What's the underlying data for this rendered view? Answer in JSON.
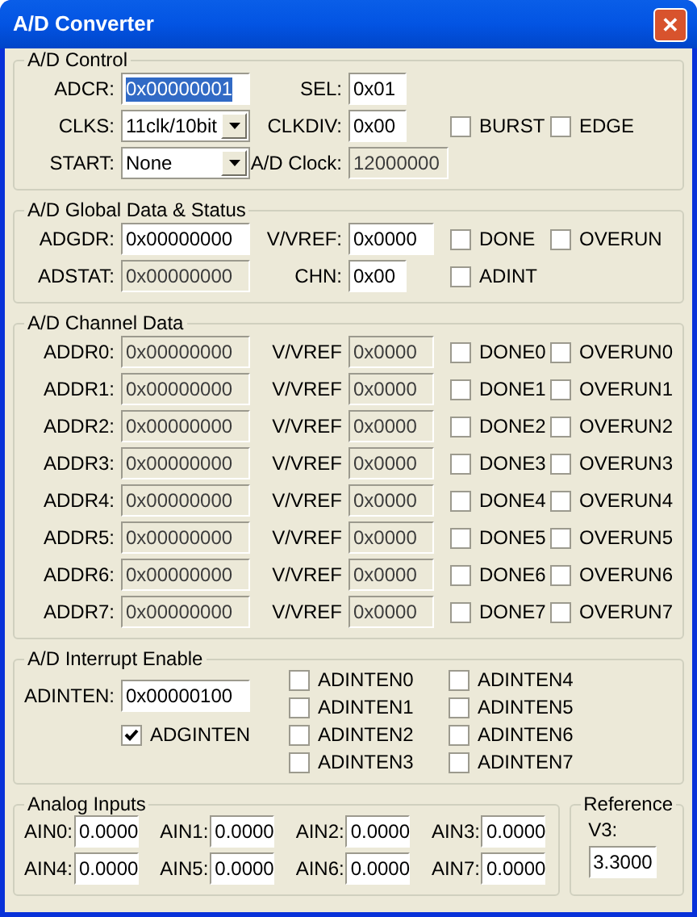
{
  "window": {
    "title": "A/D Converter",
    "close": "✕"
  },
  "ad_control": {
    "title": "A/D Control",
    "adcr": {
      "label": "ADCR:",
      "value": "0x00000001",
      "readonly": false,
      "text_selected": true
    },
    "sel": {
      "label": "SEL:",
      "value": "0x01",
      "readonly": false
    },
    "clks": {
      "label": "CLKS:",
      "value": "11clk/10bit"
    },
    "clkdiv": {
      "label": "CLKDIV:",
      "value": "0x00",
      "readonly": false
    },
    "start": {
      "label": "START:",
      "value": "None"
    },
    "ad_clock": {
      "label": "A/D Clock:",
      "value": "12000000",
      "readonly": true
    },
    "checkboxes": [
      {
        "label": "BURST",
        "checked": false
      },
      {
        "label": "EDGE",
        "checked": false
      }
    ]
  },
  "global": {
    "title": "A/D Global Data & Status",
    "adgdr": {
      "label": "ADGDR:",
      "value": "0x00000000",
      "readonly": false
    },
    "vvref": {
      "label": "V/VREF:",
      "value": "0x0000",
      "readonly": false
    },
    "adstat": {
      "label": "ADSTAT:",
      "value": "0x00000000",
      "readonly": true
    },
    "chn": {
      "label": "CHN:",
      "value": "0x00",
      "readonly": false
    },
    "row1_checkboxes": [
      {
        "label": "DONE",
        "checked": false
      },
      {
        "label": "OVERUN",
        "checked": false
      }
    ],
    "row2_checkboxes": [
      {
        "label": "ADINT",
        "checked": false
      }
    ]
  },
  "channels": {
    "title": "A/D Channel Data",
    "rows": [
      {
        "label": "ADDR0:",
        "value": "0x00000000",
        "readonly": true,
        "vref_label": "V/VREF",
        "vref_value": "0x0000",
        "vref_readonly": true,
        "done": {
          "label": "DONE0",
          "checked": false
        },
        "overrun": {
          "label": "OVERUN0",
          "checked": false
        }
      },
      {
        "label": "ADDR1:",
        "value": "0x00000000",
        "readonly": true,
        "vref_label": "V/VREF",
        "vref_value": "0x0000",
        "vref_readonly": true,
        "done": {
          "label": "DONE1",
          "checked": false
        },
        "overrun": {
          "label": "OVERUN1",
          "checked": false
        }
      },
      {
        "label": "ADDR2:",
        "value": "0x00000000",
        "readonly": true,
        "vref_label": "V/VREF",
        "vref_value": "0x0000",
        "vref_readonly": true,
        "done": {
          "label": "DONE2",
          "checked": false
        },
        "overrun": {
          "label": "OVERUN2",
          "checked": false
        }
      },
      {
        "label": "ADDR3:",
        "value": "0x00000000",
        "readonly": true,
        "vref_label": "V/VREF",
        "vref_value": "0x0000",
        "vref_readonly": true,
        "done": {
          "label": "DONE3",
          "checked": false
        },
        "overrun": {
          "label": "OVERUN3",
          "checked": false
        }
      },
      {
        "label": "ADDR4:",
        "value": "0x00000000",
        "readonly": true,
        "vref_label": "V/VREF",
        "vref_value": "0x0000",
        "vref_readonly": true,
        "done": {
          "label": "DONE4",
          "checked": false
        },
        "overrun": {
          "label": "OVERUN4",
          "checked": false
        }
      },
      {
        "label": "ADDR5:",
        "value": "0x00000000",
        "readonly": true,
        "vref_label": "V/VREF",
        "vref_value": "0x0000",
        "vref_readonly": true,
        "done": {
          "label": "DONE5",
          "checked": false
        },
        "overrun": {
          "label": "OVERUN5",
          "checked": false
        }
      },
      {
        "label": "ADDR6:",
        "value": "0x00000000",
        "readonly": true,
        "vref_label": "V/VREF",
        "vref_value": "0x0000",
        "vref_readonly": true,
        "done": {
          "label": "DONE6",
          "checked": false
        },
        "overrun": {
          "label": "OVERUN6",
          "checked": false
        }
      },
      {
        "label": "ADDR7:",
        "value": "0x00000000",
        "readonly": true,
        "vref_label": "V/VREF",
        "vref_value": "0x0000",
        "vref_readonly": true,
        "done": {
          "label": "DONE7",
          "checked": false
        },
        "overrun": {
          "label": "OVERUN7",
          "checked": false
        }
      }
    ]
  },
  "interrupt": {
    "title": "A/D Interrupt Enable",
    "adinten": {
      "label": "ADINTEN:",
      "value": "0x00000100",
      "readonly": false
    },
    "adginten": {
      "label": "ADGINTEN",
      "checked": true
    },
    "bits": [
      {
        "label": "ADINTEN0",
        "checked": false
      },
      {
        "label": "ADINTEN1",
        "checked": false
      },
      {
        "label": "ADINTEN2",
        "checked": false
      },
      {
        "label": "ADINTEN3",
        "checked": false
      },
      {
        "label": "ADINTEN4",
        "checked": false
      },
      {
        "label": "ADINTEN5",
        "checked": false
      },
      {
        "label": "ADINTEN6",
        "checked": false
      },
      {
        "label": "ADINTEN7",
        "checked": false
      }
    ]
  },
  "analog_inputs": {
    "title": "Analog Inputs",
    "inputs": [
      {
        "label": "AIN0:",
        "value": "0.0000"
      },
      {
        "label": "AIN1:",
        "value": "0.0000"
      },
      {
        "label": "AIN2:",
        "value": "0.0000"
      },
      {
        "label": "AIN3:",
        "value": "0.0000"
      },
      {
        "label": "AIN4:",
        "value": "0.0000"
      },
      {
        "label": "AIN5:",
        "value": "0.0000"
      },
      {
        "label": "AIN6:",
        "value": "0.0000"
      },
      {
        "label": "AIN7:",
        "value": "0.0000"
      }
    ]
  },
  "reference": {
    "title": "Reference",
    "label": "V3:",
    "value": "3.3000"
  }
}
